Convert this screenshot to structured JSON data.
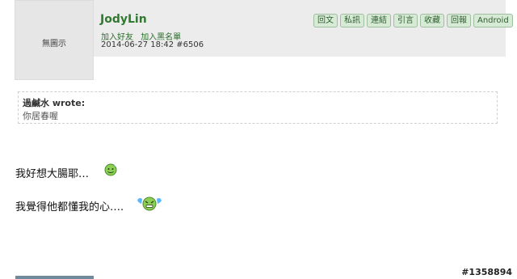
{
  "post": {
    "avatar_text": "無圖示",
    "username": "JodyLin",
    "links": [
      "加入好友",
      "加入黑名單"
    ],
    "meta": "2014-06-27 18:42 #6506",
    "buttons": [
      "回文",
      "私訊",
      "連結",
      "引言",
      "收藏",
      "回報",
      "Android"
    ]
  },
  "quote": {
    "author": "過鹹水 wrote:",
    "text": "你居春喔"
  },
  "content": {
    "line1": "我好想大腸耶…",
    "line2": "我覺得他都懂我的心…."
  },
  "footer": {
    "id": "#1358894"
  },
  "colors": {
    "accent_green": "#2f7a2f",
    "button_bg": "#d6ead6",
    "header_bg": "#ececec"
  },
  "icons": {
    "smiley1": "sweat-smiley-icon",
    "smiley2": "crying-smiley-icon"
  }
}
